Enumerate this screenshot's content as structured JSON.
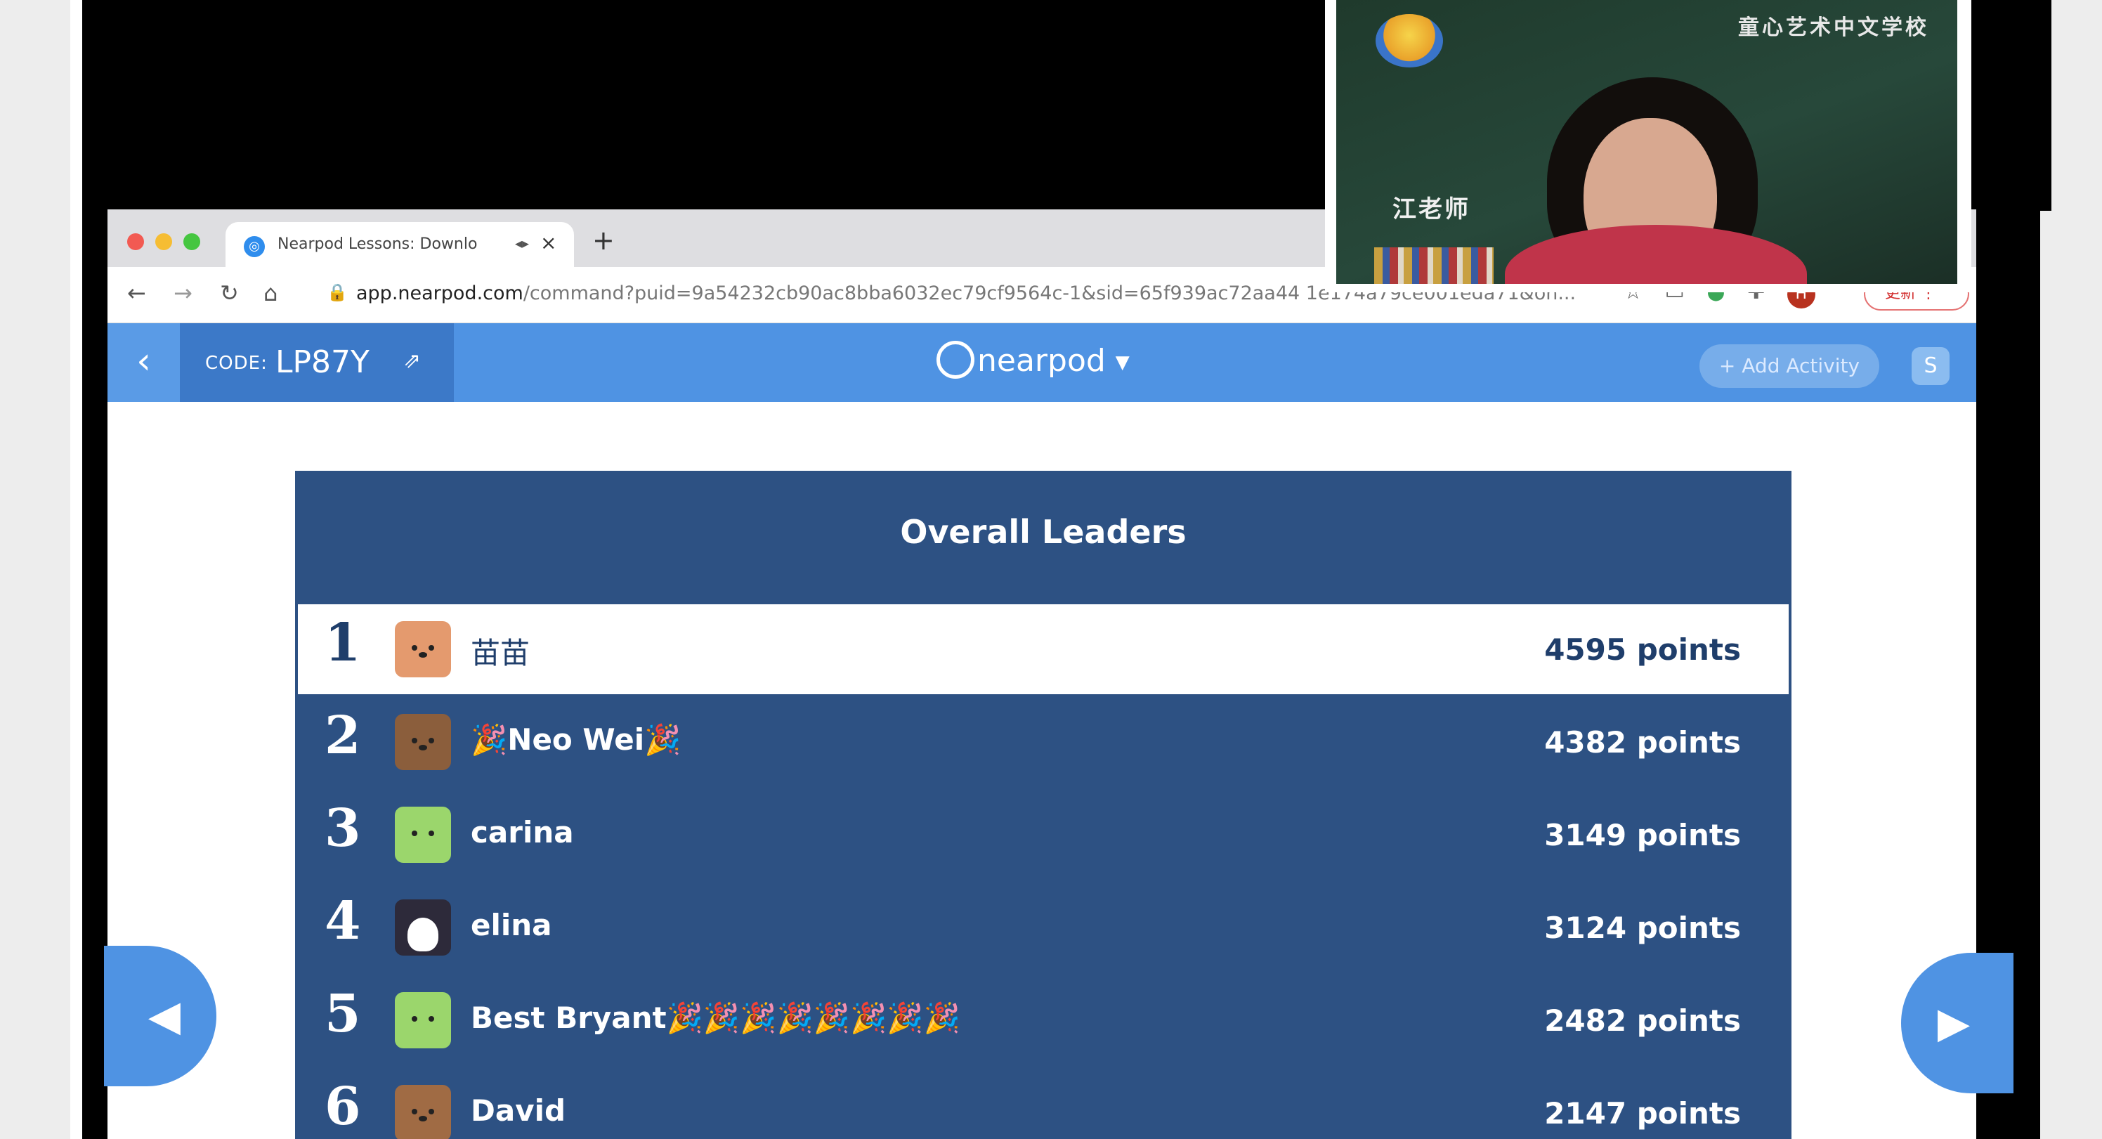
{
  "browser": {
    "tab_title": "Nearpod Lessons: Downlo",
    "tab_audio_icon": "speaker-icon",
    "tab_close": "×",
    "new_tab": "+",
    "url_host": "app.nearpod.com",
    "url_path": "/command?puid=9a54232cb90ac8bba6032ec79cf9564c-1&sid=65f939ac72aa44 1e174a79ce001eda71&on...",
    "profile_initial": "H",
    "update_label": "更新 ⋮"
  },
  "nearpod": {
    "code_label": "CODE:",
    "code_value": "LP87Y",
    "logo_text": "nearpod",
    "add_activity": "+ Add Activity",
    "s_badge": "S"
  },
  "leaderboard": {
    "title": "Overall Leaders",
    "rows": [
      {
        "rank": "1",
        "name": "苗苗",
        "points": "4595 points",
        "avatar": "fox"
      },
      {
        "rank": "2",
        "name": "🎉Neo Wei🎉",
        "points": "4382 points",
        "avatar": "bear"
      },
      {
        "rank": "3",
        "name": "carina",
        "points": "3149 points",
        "avatar": "green-monster"
      },
      {
        "rank": "4",
        "name": "elina",
        "points": "3124 points",
        "avatar": "penguin"
      },
      {
        "rank": "5",
        "name": "Best Bryant🎉🎉🎉🎉🎉🎉🎉🎉",
        "points": "2482 points",
        "avatar": "green-monster"
      },
      {
        "rank": "6",
        "name": "David",
        "points": "2147 points",
        "avatar": "brown-bear"
      }
    ]
  },
  "webcam": {
    "school_name": "童心艺术中文学校",
    "teacher_label": "江老师"
  },
  "colors": {
    "nearpod_blue": "#4f93e3",
    "board_navy": "#2d5183",
    "code_box": "#3c79c8"
  }
}
